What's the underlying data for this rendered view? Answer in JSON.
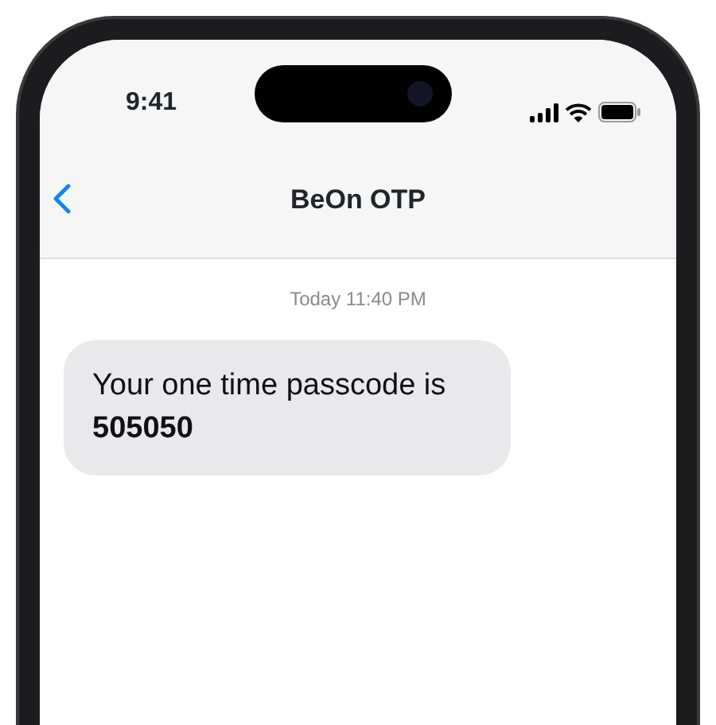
{
  "status_bar": {
    "time": "9:41"
  },
  "header": {
    "title": "BeOn OTP"
  },
  "messages": [
    {
      "timestamp": "Today 11:40 PM",
      "text": "Your one time passcode is **505050**"
    }
  ]
}
